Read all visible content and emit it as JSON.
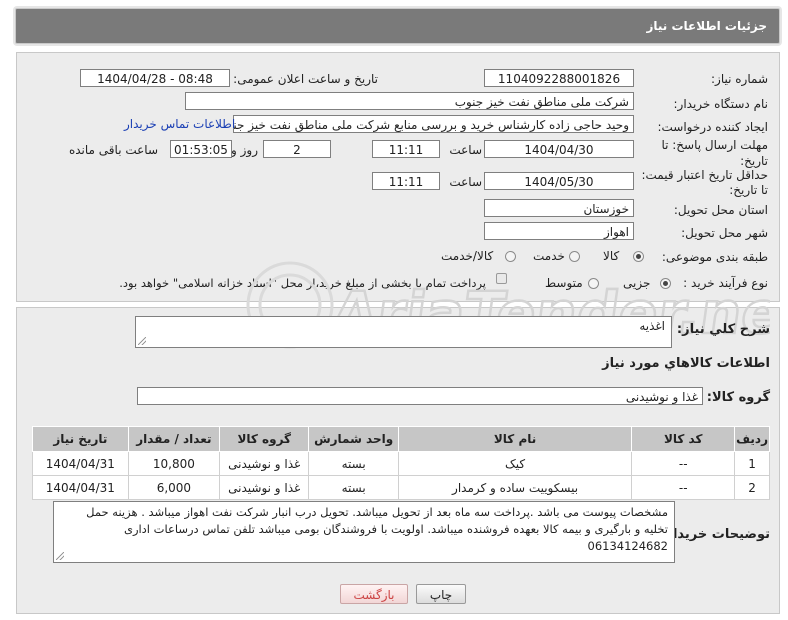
{
  "header": {
    "title": "جزئیات اطلاعات نیاز"
  },
  "fields": {
    "need_number_label": "شماره نیاز:",
    "need_number": "1104092288001826",
    "announce_label": "تاریخ و ساعت اعلان عمومی:",
    "announce_value": "1404/04/28 - 08:48",
    "buyer_org_label": "نام دستگاه خریدار:",
    "buyer_org": "شرکت ملی مناطق نفت خیز جنوب",
    "requester_label": "ایجاد کننده درخواست:",
    "requester": "وحید حاجی زاده  کارشناس خرید و بررسی منابع  شرکت ملی مناطق نفت خیز جنوب",
    "contact_link": "اطلاعات تماس خریدار",
    "deadline_label_1": "مهلت ارسال پاسخ: تا",
    "deadline_label_2": "تاریخ:",
    "deadline_date": "1404/04/30",
    "time_label": "ساعت",
    "deadline_time": "11:11",
    "days_value": "2",
    "days_label": "روز و",
    "remaining_time": "01:53:05",
    "remaining_label": "ساعت باقی مانده",
    "min_validity_label_1": "حداقل تاریخ اعتبار قیمت:",
    "min_validity_label_2": "تا تاریخ:",
    "validity_date": "1404/05/30",
    "validity_time": "11:11",
    "province_label": "استان محل تحویل:",
    "province": "خوزستان",
    "city_label": "شهر محل تحویل:",
    "city": "اهواز",
    "category_label": "طبقه بندی موضوعی:",
    "category_options": [
      "کالا",
      "خدمت",
      "کالا/خدمت"
    ],
    "process_label": "نوع فرآیند خرید :",
    "process_options": [
      "جزیی",
      "متوسط"
    ],
    "payment_note": "پرداخت تمام یا بخشی از مبلغ خرید،از محل \"اسناد خزانه اسلامی\" خواهد بود."
  },
  "description": {
    "label": "شرح كلي نياز:",
    "value": "اغذیه"
  },
  "goods": {
    "section_title": "اطلاعات كالاهاي مورد نياز",
    "group_label": "گروه کالا:",
    "group_value": "غذا و نوشیدنی",
    "columns": [
      "ردیف",
      "کد کالا",
      "نام کالا",
      "واحد شمارش",
      "گروه کالا",
      "تعداد / مقدار",
      "تاریخ نیاز"
    ],
    "rows": [
      [
        "1",
        "--",
        "کیک",
        "بسته",
        "غذا و نوشیدنی",
        "10,800",
        "1404/04/31"
      ],
      [
        "2",
        "--",
        "بیسکوییت ساده و کرمدار",
        "بسته",
        "غذا و نوشیدنی",
        "6,000",
        "1404/04/31"
      ]
    ]
  },
  "buyer_notes": {
    "label": "توضیحات خریدار:",
    "value": "مشخصات پیوست می باشد .پرداخت سه ماه بعد از تحویل میباشد.   تحویل درب انبار شرکت نفت اهواز میباشد .  هزینه حمل تخلیه و بارگیری و بیمه کالا بعهده فروشنده میباشد.  اولویت با فروشندگان بومی میباشد  تلفن تماس درساعات اداری 06134124682"
  },
  "buttons": {
    "print": "چاپ",
    "back": "بازگشت"
  },
  "watermark": {
    "text": "AriaTender.neT"
  },
  "colors": {
    "header_bg": "#7a7a7a",
    "panel_bg": "#ececec",
    "link": "#1a3fb4",
    "table_header": "#c6c6c6"
  }
}
